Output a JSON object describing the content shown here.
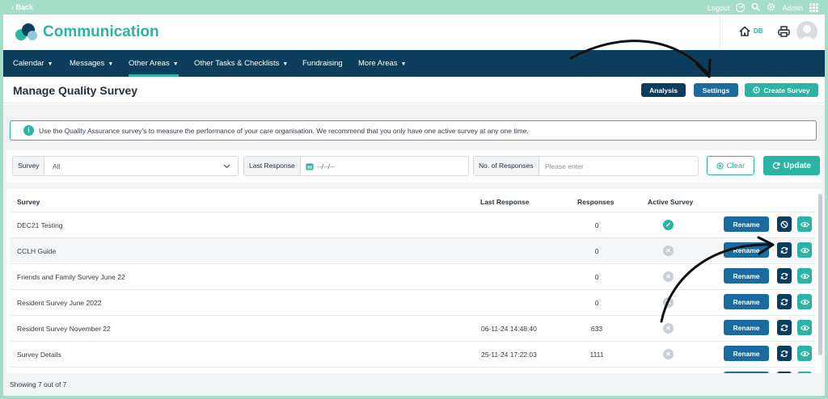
{
  "topbar": {
    "back_label": "‹ Back",
    "logout_label": "Logout",
    "user_label": "Admin"
  },
  "header": {
    "brand": "Communication",
    "home_badge": "DB"
  },
  "nav": {
    "items": [
      {
        "label": "Calendar",
        "has_menu": true
      },
      {
        "label": "Messages",
        "has_menu": true
      },
      {
        "label": "Other Areas",
        "has_menu": true,
        "active": true
      },
      {
        "label": "Other Tasks & Checklists",
        "has_menu": true
      },
      {
        "label": "Fundraising",
        "has_menu": false
      },
      {
        "label": "More Areas",
        "has_menu": true
      }
    ]
  },
  "page": {
    "title": "Manage Quality Survey",
    "analysis_label": "Analysis",
    "settings_label": "Settings",
    "create_label": "Create Survey"
  },
  "info": {
    "text": "Use the Quality Assurance survey's to measure the performance of your care organisation. We recommend that you only have one active survey at any one time."
  },
  "filters": {
    "survey_label": "Survey",
    "survey_value": "All",
    "last_response_label": "Last Response",
    "last_response_placeholder": "--/--/--",
    "responses_label": "No. of Responses",
    "responses_placeholder": "Please enter",
    "clear_label": "Clear",
    "update_label": "Update"
  },
  "table": {
    "columns": [
      "Survey",
      "Last Response",
      "Responses",
      "Active Survey"
    ],
    "rename_label": "Rename",
    "rows": [
      {
        "survey": "DEC21 Testing",
        "last_response": "",
        "responses": "0",
        "active": true
      },
      {
        "survey": "CCLH Guide",
        "last_response": "",
        "responses": "0",
        "active": false
      },
      {
        "survey": "Friends and Family Survey June 22",
        "last_response": "",
        "responses": "0",
        "active": false
      },
      {
        "survey": "Resident Survey June 2022",
        "last_response": "",
        "responses": "0",
        "active": false
      },
      {
        "survey": "Resident Survey November 22",
        "last_response": "06-11-24 14:48:40",
        "responses": "633",
        "active": false
      },
      {
        "survey": "Survey Details",
        "last_response": "25-11-24 17:22:03",
        "responses": "1111",
        "active": false
      }
    ]
  },
  "footer": {
    "showing": "Showing 7 out of 7"
  },
  "colors": {
    "accent": "#2bb3a3",
    "navy": "#0c3d5c",
    "blue": "#1a6ba0",
    "mint": "#a6ddc9"
  }
}
